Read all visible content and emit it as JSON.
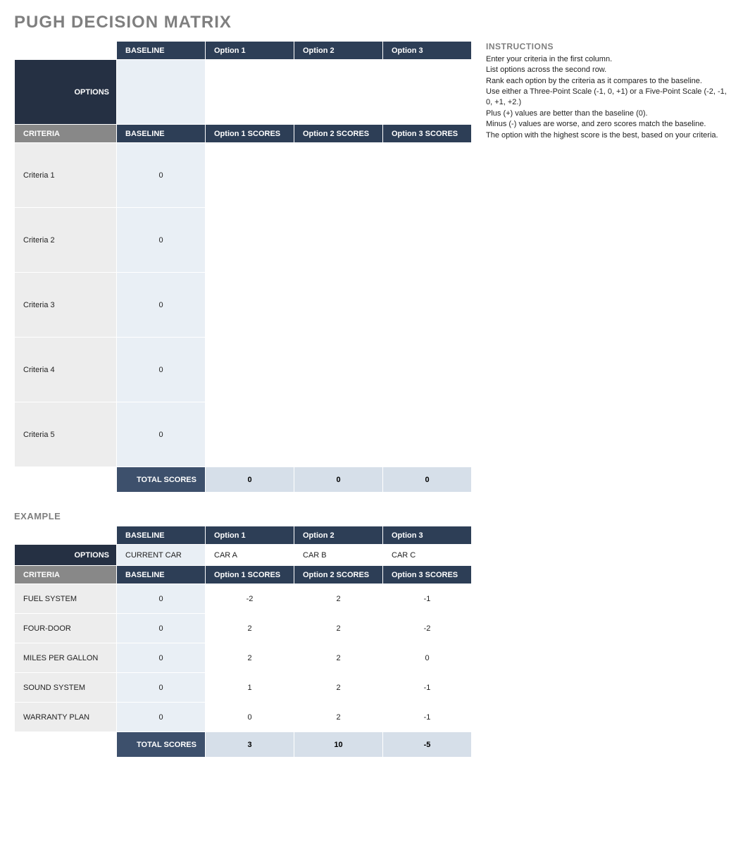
{
  "title": "PUGH DECISION MATRIX",
  "main": {
    "options_label": "OPTIONS",
    "criteria_label": "CRITERIA",
    "headers_top": [
      "BASELINE",
      "Option 1",
      "Option 2",
      "Option 3"
    ],
    "headers_scores": [
      "BASELINE",
      "Option 1 SCORES",
      "Option 2 SCORES",
      "Option 3 SCORES"
    ],
    "option_values": [
      "",
      "",
      "",
      ""
    ],
    "criteria": [
      {
        "name": "Criteria 1",
        "baseline": "0",
        "s1": "",
        "s2": "",
        "s3": ""
      },
      {
        "name": "Criteria 2",
        "baseline": "0",
        "s1": "",
        "s2": "",
        "s3": ""
      },
      {
        "name": "Criteria 3",
        "baseline": "0",
        "s1": "",
        "s2": "",
        "s3": ""
      },
      {
        "name": "Criteria 4",
        "baseline": "0",
        "s1": "",
        "s2": "",
        "s3": ""
      },
      {
        "name": "Criteria 5",
        "baseline": "0",
        "s1": "",
        "s2": "",
        "s3": ""
      }
    ],
    "total_label": "TOTAL SCORES",
    "totals": [
      "0",
      "0",
      "0"
    ]
  },
  "instructions": {
    "title": "INSTRUCTIONS",
    "lines": [
      "Enter your criteria in the first column.",
      "List options across the second row.",
      "Rank each option by the criteria as it compares to the baseline.",
      "Use either a Three-Point Scale (-1, 0, +1) or a Five-Point Scale (-2, -1, 0, +1, +2.)",
      "Plus (+) values are better than the baseline (0).",
      "Minus (-) values are worse, and zero scores match the baseline.",
      "The option with the highest score is the best, based on your criteria."
    ]
  },
  "example_label": "EXAMPLE",
  "example": {
    "options_label": "OPTIONS",
    "criteria_label": "CRITERIA",
    "headers_top": [
      "BASELINE",
      "Option 1",
      "Option 2",
      "Option 3"
    ],
    "headers_scores": [
      "BASELINE",
      "Option 1 SCORES",
      "Option 2 SCORES",
      "Option 3 SCORES"
    ],
    "option_values": [
      "CURRENT CAR",
      "CAR A",
      "CAR B",
      "CAR C"
    ],
    "criteria": [
      {
        "name": "FUEL SYSTEM",
        "baseline": "0",
        "s1": "-2",
        "s2": "2",
        "s3": "-1"
      },
      {
        "name": "FOUR-DOOR",
        "baseline": "0",
        "s1": "2",
        "s2": "2",
        "s3": "-2"
      },
      {
        "name": "MILES PER GALLON",
        "baseline": "0",
        "s1": "2",
        "s2": "2",
        "s3": "0"
      },
      {
        "name": "SOUND SYSTEM",
        "baseline": "0",
        "s1": "1",
        "s2": "2",
        "s3": "-1"
      },
      {
        "name": "WARRANTY PLAN",
        "baseline": "0",
        "s1": "0",
        "s2": "2",
        "s3": "-1"
      }
    ],
    "total_label": "TOTAL SCORES",
    "totals": [
      "3",
      "10",
      "-5"
    ]
  }
}
